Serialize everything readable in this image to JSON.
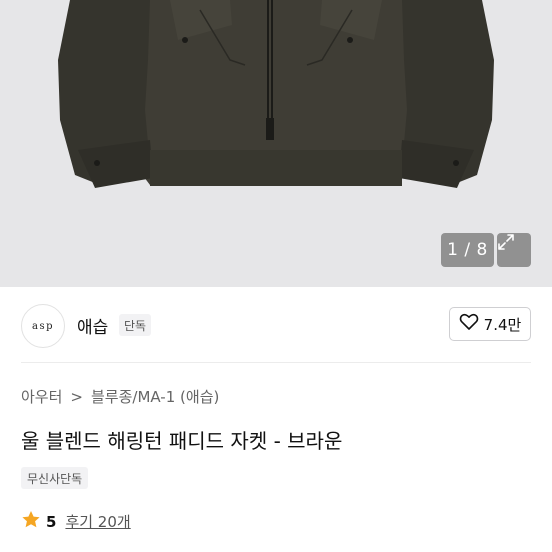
{
  "image": {
    "counter": "1 / 8",
    "icons": {
      "expand": "expand-icon"
    }
  },
  "brand": {
    "logo_text": "asp",
    "name": "애습",
    "badge": "단독",
    "likes": "7.4만",
    "icons": {
      "like": "heart-outline-icon"
    }
  },
  "breadcrumb": {
    "level1": "아우터",
    "separator": ">",
    "level2": "블루종/MA-1 (애습)"
  },
  "product": {
    "title": "울 블렌드 해링턴 패디드 자켓 - 브라운",
    "tag": "무신사단독"
  },
  "rating": {
    "value": "5",
    "reviews": "후기 20개",
    "star_color": "#f5a623"
  }
}
